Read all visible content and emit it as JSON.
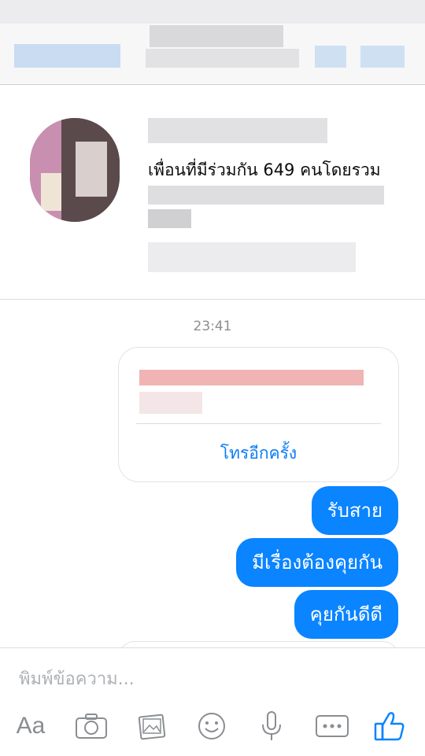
{
  "profile": {
    "mutual_friends": "เพื่อนที่มีร่วมกัน 649 คนโดยรวม"
  },
  "chat": {
    "timestamp": "23:41",
    "call_card": {
      "callback_label": "โทรอีกครั้ง"
    },
    "messages": [
      {
        "text": "รับสาย"
      },
      {
        "text": "มีเรื่องต้องคุยกัน"
      },
      {
        "text": "คุยกันดีดี"
      }
    ]
  },
  "composer": {
    "placeholder": "พิมพ์ข้อความ...",
    "aa_label": "Aa",
    "icons": [
      "camera-icon",
      "photo-icon",
      "emoji-icon",
      "microphone-icon",
      "more-icon",
      "thumbs-up-icon"
    ]
  },
  "colors": {
    "accent": "#0a84ff",
    "link": "#0a7cf5",
    "muted_text": "#8e8e93"
  }
}
